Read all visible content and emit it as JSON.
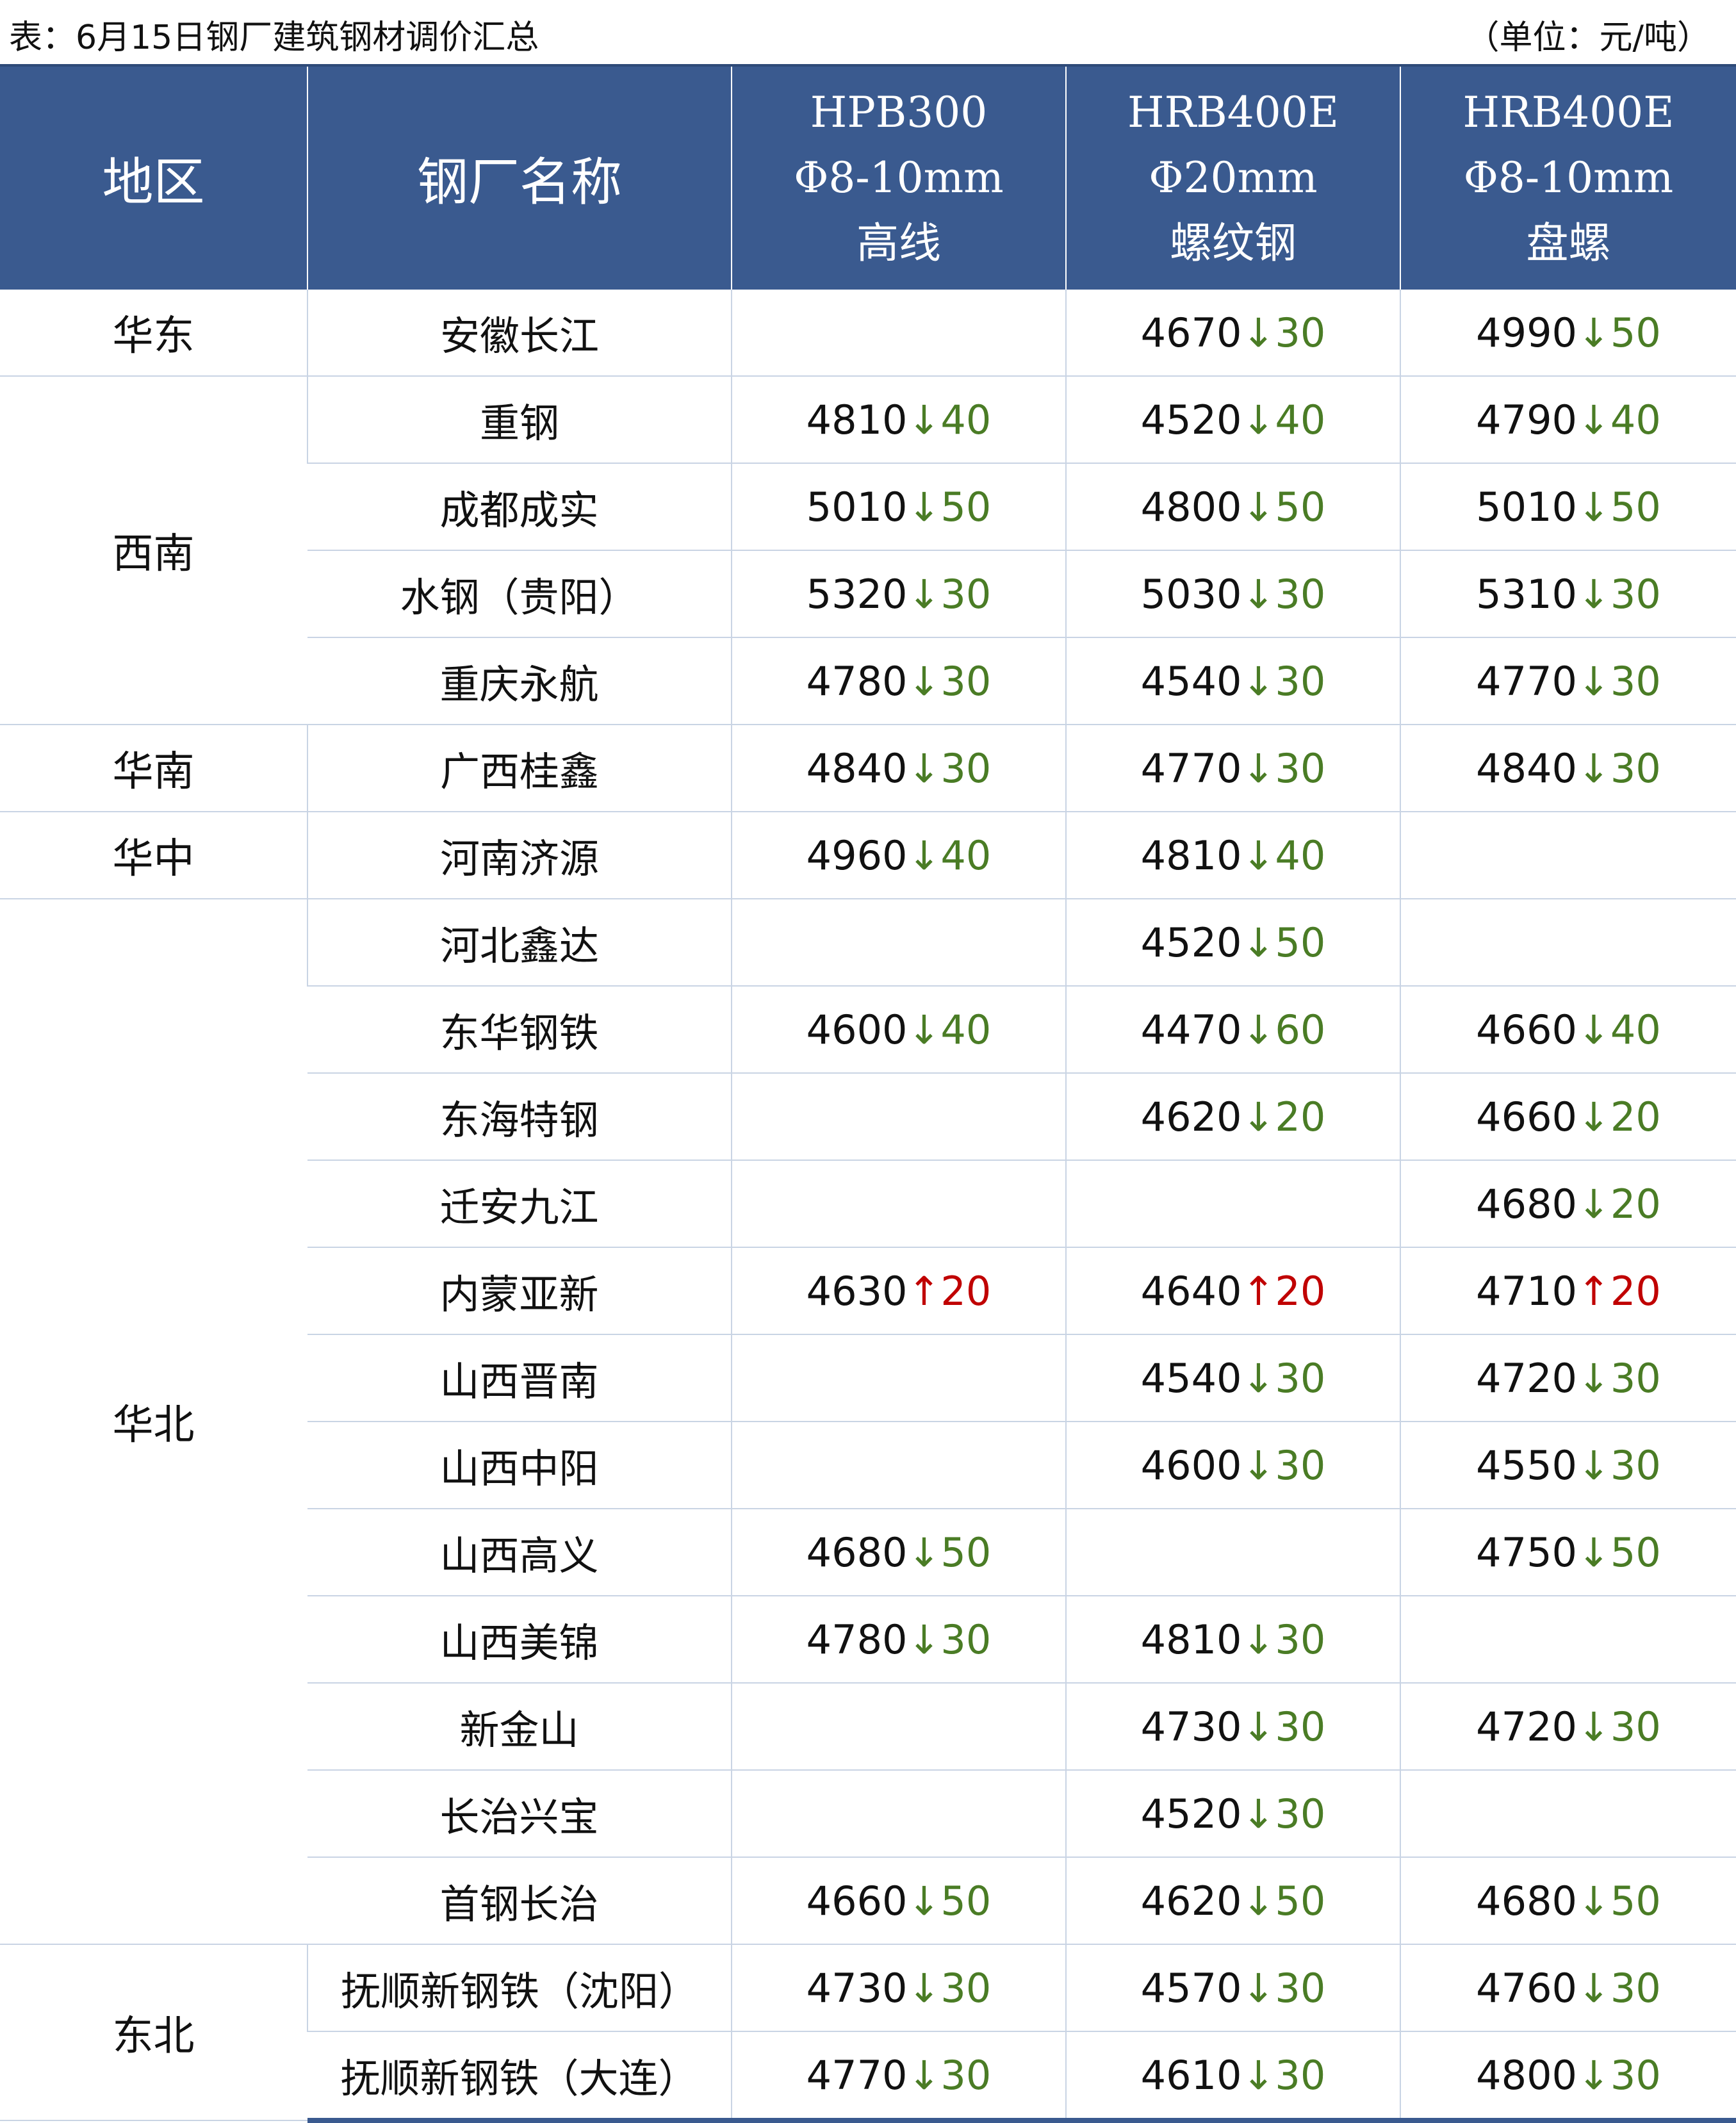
{
  "header": {
    "title": "表：6月15日钢厂建筑钢材调价汇总",
    "unit": "（单位：元/吨）"
  },
  "columns": {
    "region": "地区",
    "mill": "钢厂名称",
    "c3": [
      "HPB300",
      "Φ8-10mm",
      "高线"
    ],
    "c4": [
      "HRB400E",
      "Φ20mm",
      "螺纹钢"
    ],
    "c5": [
      "HRB400E",
      "Φ8-10mm",
      "盘螺"
    ]
  },
  "arrows": {
    "down": "↓",
    "up": "↑"
  },
  "groups": [
    {
      "region": "华东",
      "rows": [
        {
          "mill": "安徽长江",
          "c3": null,
          "c4": {
            "price": "4670",
            "dir": "down",
            "chg": "30"
          },
          "c5": {
            "price": "4990",
            "dir": "down",
            "chg": "50"
          }
        }
      ]
    },
    {
      "region": "西南",
      "rows": [
        {
          "mill": "重钢",
          "c3": {
            "price": "4810",
            "dir": "down",
            "chg": "40"
          },
          "c4": {
            "price": "4520",
            "dir": "down",
            "chg": "40"
          },
          "c5": {
            "price": "4790",
            "dir": "down",
            "chg": "40"
          }
        },
        {
          "mill": "成都成实",
          "c3": {
            "price": "5010",
            "dir": "down",
            "chg": "50"
          },
          "c4": {
            "price": "4800",
            "dir": "down",
            "chg": "50"
          },
          "c5": {
            "price": "5010",
            "dir": "down",
            "chg": "50"
          }
        },
        {
          "mill": "水钢（贵阳）",
          "c3": {
            "price": "5320",
            "dir": "down",
            "chg": "30"
          },
          "c4": {
            "price": "5030",
            "dir": "down",
            "chg": "30"
          },
          "c5": {
            "price": "5310",
            "dir": "down",
            "chg": "30"
          }
        },
        {
          "mill": "重庆永航",
          "c3": {
            "price": "4780",
            "dir": "down",
            "chg": "30"
          },
          "c4": {
            "price": "4540",
            "dir": "down",
            "chg": "30"
          },
          "c5": {
            "price": "4770",
            "dir": "down",
            "chg": "30"
          }
        }
      ]
    },
    {
      "region": "华南",
      "rows": [
        {
          "mill": "广西桂鑫",
          "c3": {
            "price": "4840",
            "dir": "down",
            "chg": "30"
          },
          "c4": {
            "price": "4770",
            "dir": "down",
            "chg": "30"
          },
          "c5": {
            "price": "4840",
            "dir": "down",
            "chg": "30"
          }
        }
      ]
    },
    {
      "region": "华中",
      "rows": [
        {
          "mill": "河南济源",
          "c3": {
            "price": "4960",
            "dir": "down",
            "chg": "40"
          },
          "c4": {
            "price": "4810",
            "dir": "down",
            "chg": "40"
          },
          "c5": null
        }
      ]
    },
    {
      "region": "华北",
      "rows": [
        {
          "mill": "河北鑫达",
          "c3": null,
          "c4": {
            "price": "4520",
            "dir": "down",
            "chg": "50"
          },
          "c5": null
        },
        {
          "mill": "东华钢铁",
          "c3": {
            "price": "4600",
            "dir": "down",
            "chg": "40"
          },
          "c4": {
            "price": "4470",
            "dir": "down",
            "chg": "60"
          },
          "c5": {
            "price": "4660",
            "dir": "down",
            "chg": "40"
          }
        },
        {
          "mill": "东海特钢",
          "c3": null,
          "c4": {
            "price": "4620",
            "dir": "down",
            "chg": "20"
          },
          "c5": {
            "price": "4660",
            "dir": "down",
            "chg": "20"
          }
        },
        {
          "mill": "迁安九江",
          "c3": null,
          "c4": null,
          "c5": {
            "price": "4680",
            "dir": "down",
            "chg": "20"
          }
        },
        {
          "mill": "内蒙亚新",
          "c3": {
            "price": "4630",
            "dir": "up",
            "chg": "20"
          },
          "c4": {
            "price": "4640",
            "dir": "up",
            "chg": "20"
          },
          "c5": {
            "price": "4710",
            "dir": "up",
            "chg": "20"
          }
        },
        {
          "mill": "山西晋南",
          "c3": null,
          "c4": {
            "price": "4540",
            "dir": "down",
            "chg": "30"
          },
          "c5": {
            "price": "4720",
            "dir": "down",
            "chg": "30"
          }
        },
        {
          "mill": "山西中阳",
          "c3": null,
          "c4": {
            "price": "4600",
            "dir": "down",
            "chg": "30"
          },
          "c5": {
            "price": "4550",
            "dir": "down",
            "chg": "30"
          }
        },
        {
          "mill": "山西高义",
          "c3": {
            "price": "4680",
            "dir": "down",
            "chg": "50"
          },
          "c4": null,
          "c5": {
            "price": "4750",
            "dir": "down",
            "chg": "50"
          }
        },
        {
          "mill": "山西美锦",
          "c3": {
            "price": "4780",
            "dir": "down",
            "chg": "30"
          },
          "c4": {
            "price": "4810",
            "dir": "down",
            "chg": "30"
          },
          "c5": null
        },
        {
          "mill": "新金山",
          "c3": null,
          "c4": {
            "price": "4730",
            "dir": "down",
            "chg": "30"
          },
          "c5": {
            "price": "4720",
            "dir": "down",
            "chg": "30"
          }
        },
        {
          "mill": "长治兴宝",
          "c3": null,
          "c4": {
            "price": "4520",
            "dir": "down",
            "chg": "30"
          },
          "c5": null
        },
        {
          "mill": "首钢长治",
          "c3": {
            "price": "4660",
            "dir": "down",
            "chg": "50"
          },
          "c4": {
            "price": "4620",
            "dir": "down",
            "chg": "50"
          },
          "c5": {
            "price": "4680",
            "dir": "down",
            "chg": "50"
          }
        }
      ]
    },
    {
      "region": "东北",
      "rows": [
        {
          "mill": "抚顺新钢铁（沈阳）",
          "c3": {
            "price": "4730",
            "dir": "down",
            "chg": "30"
          },
          "c4": {
            "price": "4570",
            "dir": "down",
            "chg": "30"
          },
          "c5": {
            "price": "4760",
            "dir": "down",
            "chg": "30"
          }
        },
        {
          "mill": "抚顺新钢铁（大连）",
          "c3": {
            "price": "4770",
            "dir": "down",
            "chg": "30"
          },
          "c4": {
            "price": "4610",
            "dir": "down",
            "chg": "30"
          },
          "c5": {
            "price": "4800",
            "dir": "down",
            "chg": "30"
          }
        }
      ]
    }
  ]
}
